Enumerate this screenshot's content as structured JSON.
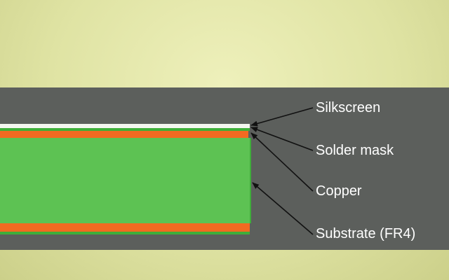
{
  "diagram": {
    "layers": [
      {
        "label": "Silkscreen"
      },
      {
        "label": "Solder mask"
      },
      {
        "label": "Copper"
      },
      {
        "label": "Substrate (FR4)"
      }
    ]
  },
  "colors": {
    "background": "#dfe3a3",
    "panel": "#5c5f5c",
    "silkscreen": "#f4f6f0",
    "solder_mask": "#3fae3a",
    "copper": "#f26a21",
    "substrate": "#5dc253",
    "arrow": "#111111",
    "label_text": "#ffffff"
  }
}
